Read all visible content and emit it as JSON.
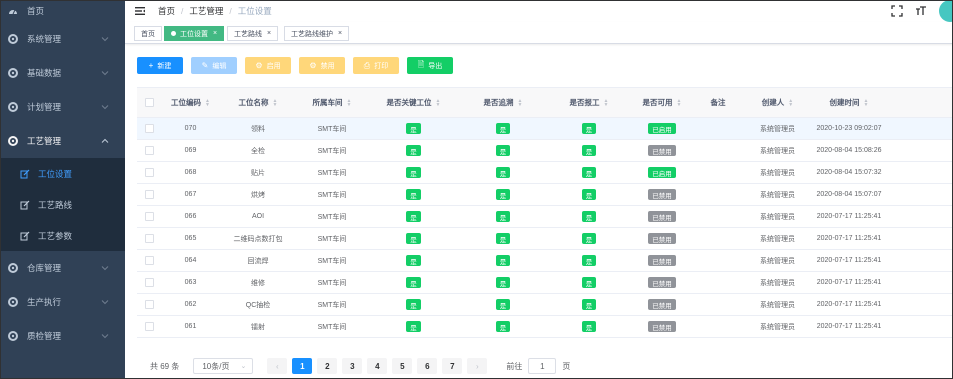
{
  "sidebar": {
    "items": [
      {
        "label": "首页",
        "icon": "dashboard-icon"
      },
      {
        "label": "系统管理",
        "icon": "gear-icon"
      },
      {
        "label": "基础数据",
        "icon": "gear-icon"
      },
      {
        "label": "计划管理",
        "icon": "gear-icon"
      },
      {
        "label": "工艺管理",
        "icon": "gear-icon"
      },
      {
        "label": "仓库管理",
        "icon": "gear-icon"
      },
      {
        "label": "生产执行",
        "icon": "gear-icon"
      },
      {
        "label": "质检管理",
        "icon": "gear-icon"
      }
    ],
    "submenu": [
      {
        "label": "工位设置"
      },
      {
        "label": "工艺路线"
      },
      {
        "label": "工艺参数"
      }
    ]
  },
  "breadcrumb": {
    "home": "首页",
    "parent": "工艺管理",
    "current": "工位设置"
  },
  "tags": {
    "home": "首页",
    "station": "工位设置",
    "route": "工艺路线",
    "route_maint": "工艺路线维护"
  },
  "toolbar": {
    "new": "新建",
    "edit": "编辑",
    "enable": "启用",
    "disable": "禁用",
    "print": "打印",
    "export": "导出"
  },
  "table": {
    "headers": [
      "工位编码",
      "工位名称",
      "所属车间",
      "是否关键工位",
      "是否追溯",
      "是否报工",
      "是否可用",
      "备注",
      "创建人",
      "创建时间"
    ],
    "rows": [
      {
        "code": "070",
        "name": "领料",
        "workshop": "SMT车间",
        "key": "是",
        "trace": "是",
        "report": "是",
        "status": "已启用",
        "enabled": true,
        "remark": "",
        "creator": "系统管理员",
        "created": "2020-10-23 09:02:07"
      },
      {
        "code": "069",
        "name": "全检",
        "workshop": "SMT车间",
        "key": "是",
        "trace": "是",
        "report": "是",
        "status": "已禁用",
        "enabled": false,
        "remark": "",
        "creator": "系统管理员",
        "created": "2020-08-04 15:08:26"
      },
      {
        "code": "068",
        "name": "贴片",
        "workshop": "SMT车间",
        "key": "是",
        "trace": "是",
        "report": "是",
        "status": "已启用",
        "enabled": true,
        "remark": "",
        "creator": "系统管理员",
        "created": "2020-08-04 15:07:32"
      },
      {
        "code": "067",
        "name": "烘烤",
        "workshop": "SMT车间",
        "key": "是",
        "trace": "是",
        "report": "是",
        "status": "已禁用",
        "enabled": false,
        "remark": "",
        "creator": "系统管理员",
        "created": "2020-08-04 15:07:07"
      },
      {
        "code": "066",
        "name": "AOI",
        "workshop": "SMT车间",
        "key": "是",
        "trace": "是",
        "report": "是",
        "status": "已禁用",
        "enabled": false,
        "remark": "",
        "creator": "系统管理员",
        "created": "2020-07-17 11:25:41"
      },
      {
        "code": "065",
        "name": "二维码点数打包",
        "workshop": "SMT车间",
        "key": "是",
        "trace": "是",
        "report": "是",
        "status": "已禁用",
        "enabled": false,
        "remark": "",
        "creator": "系统管理员",
        "created": "2020-07-17 11:25:41"
      },
      {
        "code": "064",
        "name": "回流焊",
        "workshop": "SMT车间",
        "key": "是",
        "trace": "是",
        "report": "是",
        "status": "已禁用",
        "enabled": false,
        "remark": "",
        "creator": "系统管理员",
        "created": "2020-07-17 11:25:41"
      },
      {
        "code": "063",
        "name": "维修",
        "workshop": "SMT车间",
        "key": "是",
        "trace": "是",
        "report": "是",
        "status": "已禁用",
        "enabled": false,
        "remark": "",
        "creator": "系统管理员",
        "created": "2020-07-17 11:25:41"
      },
      {
        "code": "062",
        "name": "QC抽检",
        "workshop": "SMT车间",
        "key": "是",
        "trace": "是",
        "report": "是",
        "status": "已禁用",
        "enabled": false,
        "remark": "",
        "creator": "系统管理员",
        "created": "2020-07-17 11:25:41"
      },
      {
        "code": "061",
        "name": "镭射",
        "workshop": "SMT车间",
        "key": "是",
        "trace": "是",
        "report": "是",
        "status": "已禁用",
        "enabled": false,
        "remark": "",
        "creator": "系统管理员",
        "created": "2020-07-17 11:25:41"
      }
    ]
  },
  "pagination": {
    "total": "共 69 条",
    "page_size": "10条/页",
    "pages": [
      "1",
      "2",
      "3",
      "4",
      "5",
      "6",
      "7"
    ],
    "current": "1",
    "goto_label": "前往",
    "goto_value": "1",
    "goto_suffix": "页"
  },
  "colors": {
    "sidebar": "#304156",
    "primary": "#1890ff",
    "success": "#13ce66",
    "tag_active": "#42b983"
  }
}
